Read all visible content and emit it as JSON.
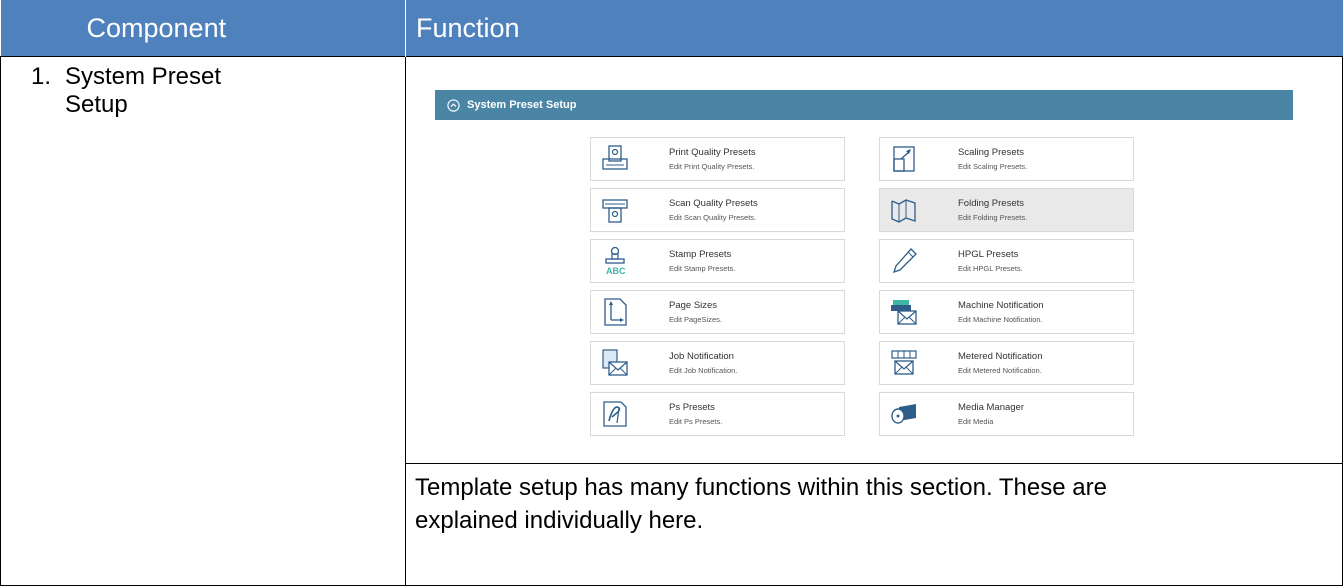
{
  "table": {
    "header_component": "Component",
    "header_function": "Function",
    "row": {
      "number": "1.",
      "component_line1": "System Preset",
      "component_line2": "Setup",
      "description_line1": "Template setup has many functions within this section. These are",
      "description_line2": "explained individually here."
    }
  },
  "panel": {
    "title": "System Preset Setup",
    "cards": [
      {
        "title": "Print Quality Presets",
        "subtitle": "Edit Print Quality Presets.",
        "icon": "print-quality-icon"
      },
      {
        "title": "Scaling Presets",
        "subtitle": "Edit Scaling Presets.",
        "icon": "scaling-icon"
      },
      {
        "title": "Scan Quality Presets",
        "subtitle": "Edit Scan Quality Presets.",
        "icon": "scan-quality-icon"
      },
      {
        "title": "Folding Presets",
        "subtitle": "Edit Folding Presets.",
        "icon": "folding-icon"
      },
      {
        "title": "Stamp Presets",
        "subtitle": "Edit Stamp Presets.",
        "icon": "stamp-icon"
      },
      {
        "title": "HPGL Presets",
        "subtitle": "Edit HPGL Presets.",
        "icon": "hpgl-pen-icon"
      },
      {
        "title": "Page Sizes",
        "subtitle": "Edit PageSizes.",
        "icon": "page-size-icon"
      },
      {
        "title": "Machine Notification",
        "subtitle": "Edit Machine Notification.",
        "icon": "machine-notification-icon"
      },
      {
        "title": "Job Notification",
        "subtitle": "Edit Job Notification.",
        "icon": "job-notification-icon"
      },
      {
        "title": "Metered Notification",
        "subtitle": "Edit Metered Notification.",
        "icon": "metered-notification-icon"
      },
      {
        "title": "Ps Presets",
        "subtitle": "Edit Ps Presets.",
        "icon": "ps-presets-icon"
      },
      {
        "title": "Media Manager",
        "subtitle": "Edit Media",
        "icon": "media-manager-icon"
      }
    ],
    "colors": {
      "header": "#4a85a6",
      "icon_blue": "#2e5d8a",
      "icon_accent": "#3fb6a8"
    }
  }
}
